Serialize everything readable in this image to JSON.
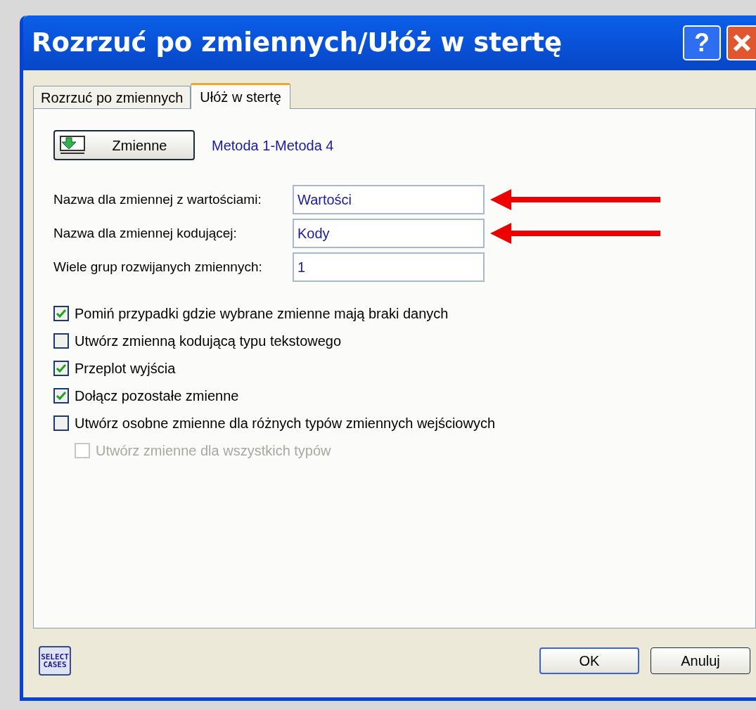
{
  "window": {
    "title": "Rozrzuć po zmiennych/Ułóż w stertę",
    "help_button": "?"
  },
  "tabs": [
    {
      "label": "Rozrzuć po zmiennych",
      "selected": false
    },
    {
      "label": "Ułóż w stertę",
      "selected": true
    }
  ],
  "variables_button": {
    "label": "Zmienne"
  },
  "variables_selection": "Metoda 1-Metoda 4",
  "fields": [
    {
      "label": "Nazwa dla zmiennej z wartościami:",
      "value": "Wartości",
      "arrow": true
    },
    {
      "label": "Nazwa dla zmiennej kodującej:",
      "value": "Kody",
      "arrow": true
    },
    {
      "label": "Wiele grup rozwijanych zmiennych:",
      "value": "1",
      "arrow": false
    }
  ],
  "options": [
    {
      "label": "Pomiń przypadki gdzie wybrane zmienne mają braki danych",
      "checked": true,
      "disabled": false
    },
    {
      "label": "Utwórz zmienną kodującą typu tekstowego",
      "checked": false,
      "disabled": false
    },
    {
      "label": "Przeplot wyjścia",
      "checked": true,
      "disabled": false
    },
    {
      "label": "Dołącz pozostałe zmienne",
      "checked": true,
      "disabled": false
    },
    {
      "label": "Utwórz osobne zmienne dla różnych typów zmiennych wejściowych",
      "checked": false,
      "disabled": false,
      "children": [
        {
          "label": "Utwórz zmienne dla wszystkich typów",
          "checked": false,
          "disabled": true
        }
      ]
    }
  ],
  "select_cases_button": {
    "line_1": "SELECT",
    "line_2": "CASES"
  },
  "buttons": [
    "OK",
    "Anuluj"
  ]
}
